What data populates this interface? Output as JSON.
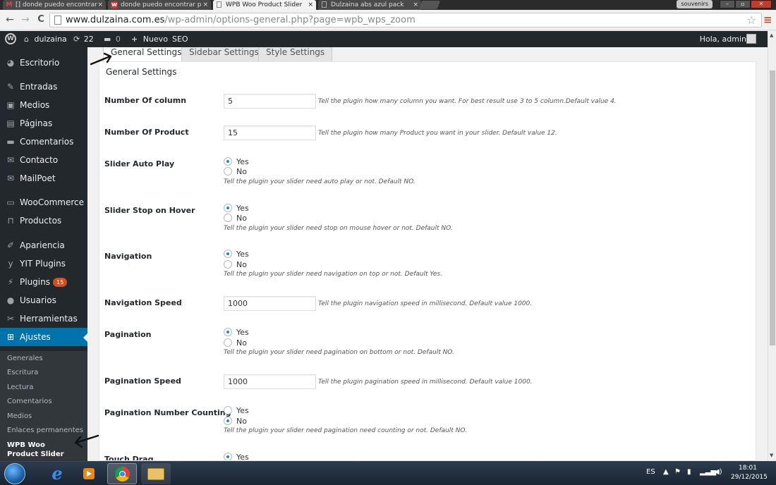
{
  "browser": {
    "tabs": [
      {
        "icon": "M",
        "title": "[] donde puedo encontrar",
        "close": "×",
        "active": false
      },
      {
        "icon": "w",
        "title": "donde puedo encontrar p",
        "close": "×",
        "active": false
      },
      {
        "icon": "",
        "title": "WPB Woo Product Slider",
        "close": "×",
        "active": true
      },
      {
        "icon": "",
        "title": "Dulzaina abs azul pack",
        "close": "×",
        "active": false
      }
    ],
    "profile": "souvenirs",
    "url_host": "www.dulzaina.com.es",
    "url_path": "/wp-admin/options-general.php?page=wpb_wps_zoom",
    "back": "←",
    "forward": "→",
    "reload": "C",
    "star": "☆",
    "menu": "≡"
  },
  "adminbar": {
    "site": "dulzaina",
    "updates": "22",
    "comments": "0",
    "new": "Nuevo",
    "seo": "SEO",
    "greeting": "Hola, admin"
  },
  "sidebar": {
    "items": [
      {
        "label": "Escritorio",
        "icon": "tachometer-icon",
        "glyph": "◕",
        "badge": ""
      },
      {
        "label": "Entradas",
        "icon": "pin-icon",
        "glyph": "✎",
        "badge": ""
      },
      {
        "label": "Medios",
        "icon": "media-icon",
        "glyph": "▣",
        "badge": ""
      },
      {
        "label": "Páginas",
        "icon": "page-icon",
        "glyph": "▤",
        "badge": ""
      },
      {
        "label": "Comentarios",
        "icon": "comment-icon",
        "glyph": "▬",
        "badge": ""
      },
      {
        "label": "Contacto",
        "icon": "mail-icon",
        "glyph": "✉",
        "badge": ""
      },
      {
        "label": "MailPoet",
        "icon": "mail-icon",
        "glyph": "✉",
        "badge": ""
      },
      {
        "label": "WooCommerce",
        "icon": "woo-icon",
        "glyph": "▭",
        "badge": ""
      },
      {
        "label": "Productos",
        "icon": "cart-icon",
        "glyph": "⊓",
        "badge": ""
      },
      {
        "label": "Apariencia",
        "icon": "brush-icon",
        "glyph": "✐",
        "badge": ""
      },
      {
        "label": "YIT Plugins",
        "icon": "yit-icon",
        "glyph": "y",
        "badge": ""
      },
      {
        "label": "Plugins",
        "icon": "plugin-icon",
        "glyph": "⚡",
        "badge": "15"
      },
      {
        "label": "Usuarios",
        "icon": "user-icon",
        "glyph": "●",
        "badge": ""
      },
      {
        "label": "Herramientas",
        "icon": "wrench-icon",
        "glyph": "✂",
        "badge": ""
      },
      {
        "label": "Ajustes",
        "icon": "settings-icon",
        "glyph": "⊞",
        "badge": ""
      }
    ],
    "submenu": [
      "Generales",
      "Escritura",
      "Lectura",
      "Comentarios",
      "Medios",
      "Enlaces permanentes",
      "WPB Woo Product Slider"
    ]
  },
  "settings_tabs": [
    "General Settings",
    "Sidebar Settings",
    "Style Settings"
  ],
  "panel": {
    "heading": "General Settings",
    "fields": {
      "columns": {
        "label": "Number Of column",
        "value": "5",
        "desc": "Tell the plugin how many column you want. For best result use 3 to 5 column.Default value 4."
      },
      "products": {
        "label": "Number Of Product",
        "value": "15",
        "desc": "Tell the plugin how many Product you want in your slider. Default value 12."
      },
      "autoplay": {
        "label": "Slider Auto Play",
        "yes": "Yes",
        "no": "No",
        "desc": "Tell the plugin your slider need auto play or not. Default NO."
      },
      "hover": {
        "label": "Slider Stop on Hover",
        "yes": "Yes",
        "no": "No",
        "desc": "Tell the plugin your slider need stop on mouse hover or not. Default NO."
      },
      "navigation": {
        "label": "Navigation",
        "yes": "Yes",
        "no": "No",
        "desc": "Tell the plugin your slider need navigation on top or not. Default Yes."
      },
      "nav_speed": {
        "label": "Navigation Speed",
        "value": "1000",
        "desc": "Tell the plugin navigation speed in millisecond. Default value 1000."
      },
      "pagination": {
        "label": "Pagination",
        "yes": "Yes",
        "no": "No",
        "desc": "Tell the plugin your slider need pagination on bottom or not. Default NO."
      },
      "pag_speed": {
        "label": "Pagination Speed",
        "value": "1000",
        "desc": "Tell the plugin pagination speed in millisecond. Default value 1000."
      },
      "pag_count": {
        "label": "Pagination Number Counting",
        "yes": "Yes",
        "no": "No",
        "desc": "Tell the plugin your slider need pagination need counting or not. Default NO."
      },
      "touch": {
        "label": "Touch Drag",
        "yes": "Yes"
      }
    }
  },
  "taskbar": {
    "lang": "ES",
    "time": "18:01",
    "date": "29/12/2015"
  }
}
